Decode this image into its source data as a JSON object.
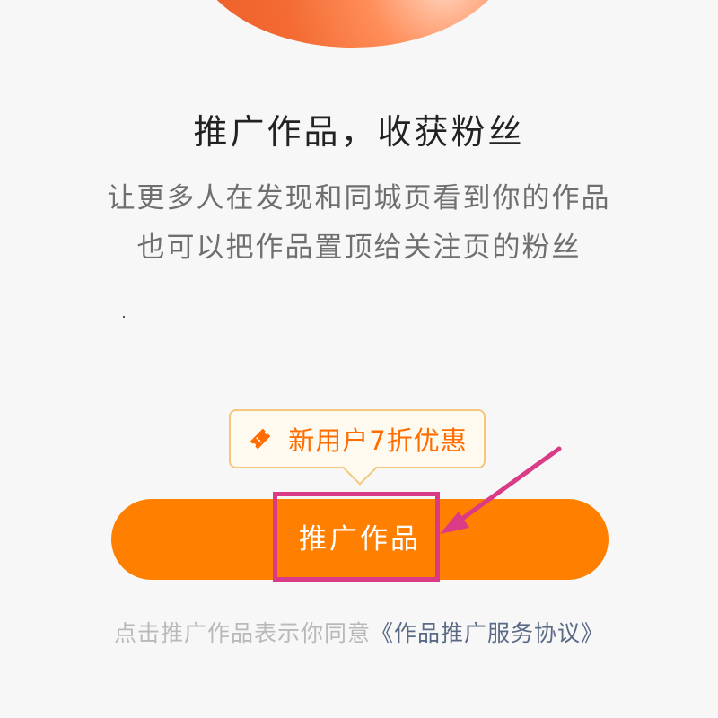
{
  "main": {
    "title": "推广作品，收获粉丝",
    "description_line1": "让更多人在发现和同城页看到你的作品",
    "description_line2": "也可以把作品置顶给关注页的粉丝"
  },
  "promo": {
    "badge_text": "新用户7折优惠",
    "icon": "ticket-icon"
  },
  "action": {
    "promote_label": "推广作品"
  },
  "footer": {
    "agreement_prefix": "点击推广作品表示你同意",
    "agreement_link": "《作品推广服务协议》"
  },
  "colors": {
    "primary": "#ff7f00",
    "badge_text": "#ff6c00",
    "annotation": "#d93b87",
    "link": "#5a6a85"
  }
}
